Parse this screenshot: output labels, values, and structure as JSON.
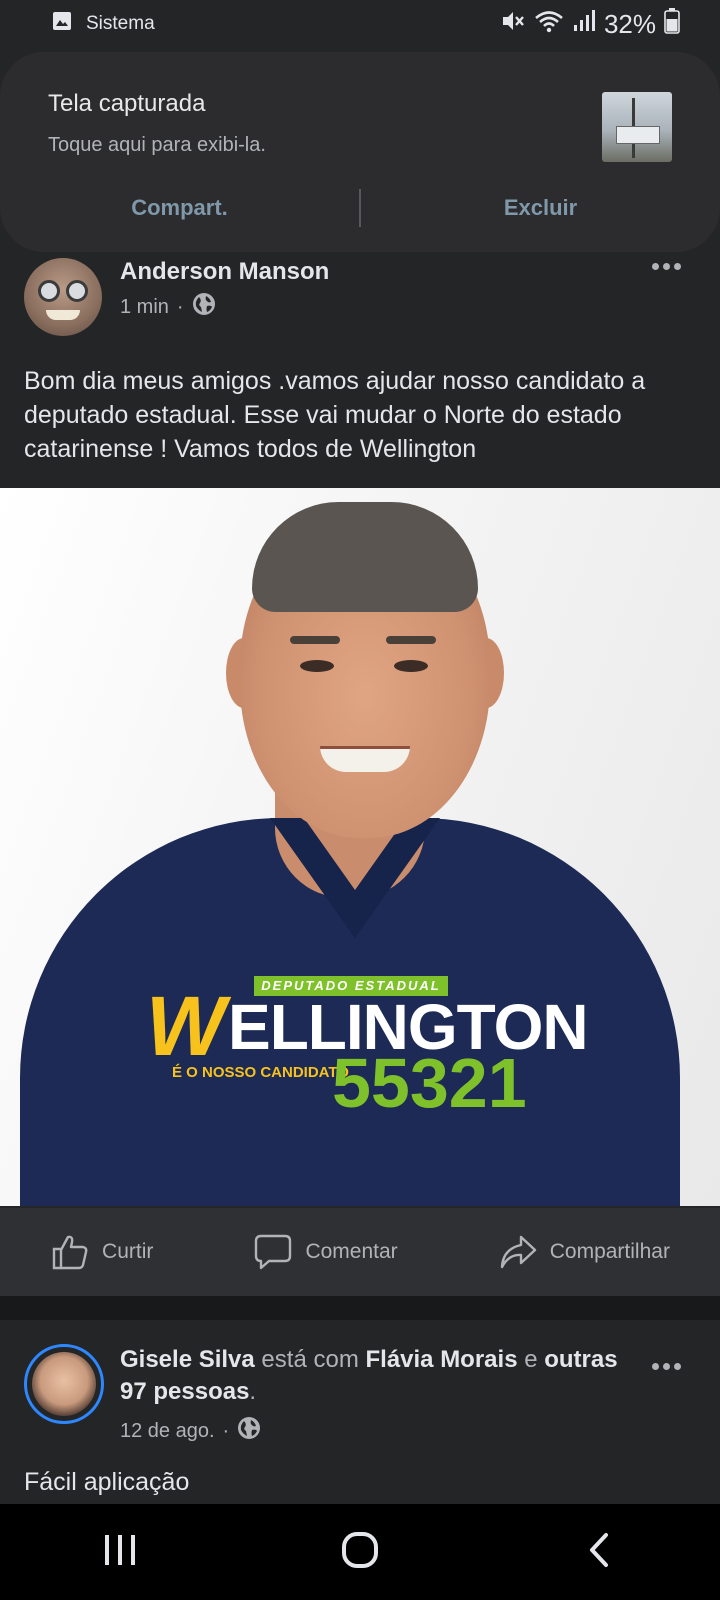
{
  "status_bar": {
    "app_label": "Sistema",
    "battery": "32%",
    "icons": [
      "image-icon",
      "mute-icon",
      "wifi-icon",
      "signal-icon",
      "battery-icon"
    ]
  },
  "notification": {
    "title": "Tela capturada",
    "subtitle": "Toque aqui para exibi-la.",
    "share_label": "Compart.",
    "delete_label": "Excluir"
  },
  "post1": {
    "author": "Anderson Manson",
    "time": "1 min",
    "privacy_icon": "globe-icon",
    "text": "Bom dia meus amigos .vamos ajudar nosso candidato a deputado estadual.  Esse vai mudar o Norte do estado catarinense ! Vamos todos de Wellington",
    "image": {
      "tag": "DEPUTADO ESTADUAL",
      "w_letter": "W",
      "name": "ELLINGTON",
      "subtitle": "É O NOSSO CANDIDATO",
      "number": "55321"
    }
  },
  "actions": {
    "like": "Curtir",
    "comment": "Comentar",
    "share": "Compartilhar"
  },
  "post2": {
    "author": "Gisele Silva",
    "with_text": " está com ",
    "tagged": "Flávia Morais",
    "and_text": " e ",
    "others": "outras 97 pessoas",
    "period": ".",
    "time": "12 de ago.",
    "text": "Fácil aplicação"
  },
  "colors": {
    "background": "#242526",
    "accent_blue": "#2d88ff",
    "logo_yellow": "#f7c21c",
    "logo_green": "#7ec12a"
  }
}
